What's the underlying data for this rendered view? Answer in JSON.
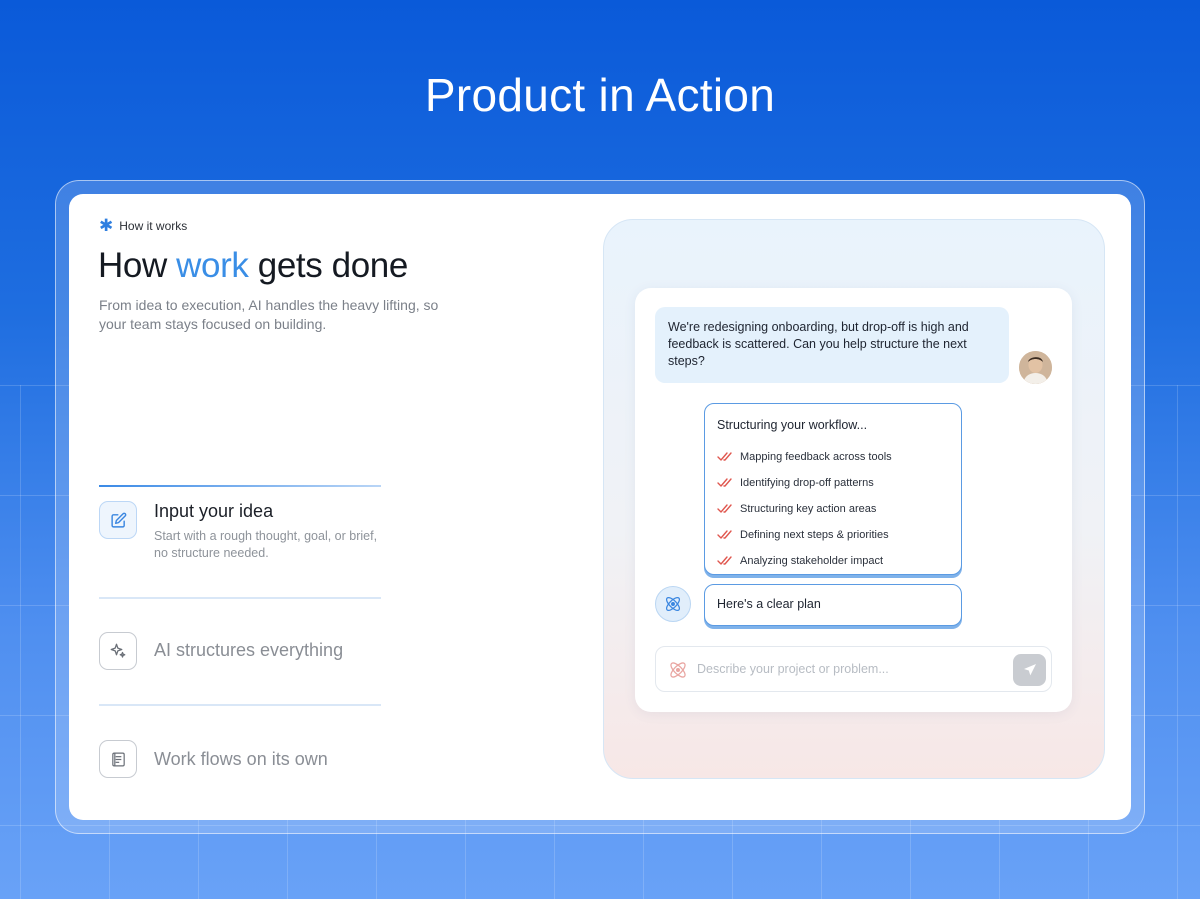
{
  "hero": {
    "title": "Product in Action"
  },
  "section": {
    "eyebrow": "How it works",
    "headline_prefix": "How ",
    "headline_accent": "work",
    "headline_suffix": " gets done",
    "subhead": "From idea to execution, AI handles the heavy lifting, so your team stays focused on building."
  },
  "steps": [
    {
      "title": "Input your idea",
      "description": "Start with a rough thought, goal, or brief, no structure needed.",
      "icon": "edit-icon",
      "active": true
    },
    {
      "title": "AI structures everything",
      "description": "",
      "icon": "sparkle-icon",
      "active": false
    },
    {
      "title": "Work flows on its own",
      "description": "",
      "icon": "document-icon",
      "active": false
    }
  ],
  "chat": {
    "user_message": "We're redesigning onboarding, but drop-off is high and feedback is scattered. Can you help structure the next steps?",
    "workflow_title": "Structuring your workflow...",
    "workflow_items": [
      "Mapping feedback across tools",
      "Identifying drop-off patterns",
      "Structuring key action areas",
      "Defining next steps & priorities",
      "Analyzing stakeholder impact"
    ],
    "assistant_reply": "Here's a clear plan",
    "composer_placeholder": "Describe your project or problem..."
  },
  "colors": {
    "accent": "#3a8ee6",
    "check": "#e0574f",
    "background_top": "#0a5ad9",
    "background_bottom": "#69a2f7"
  }
}
